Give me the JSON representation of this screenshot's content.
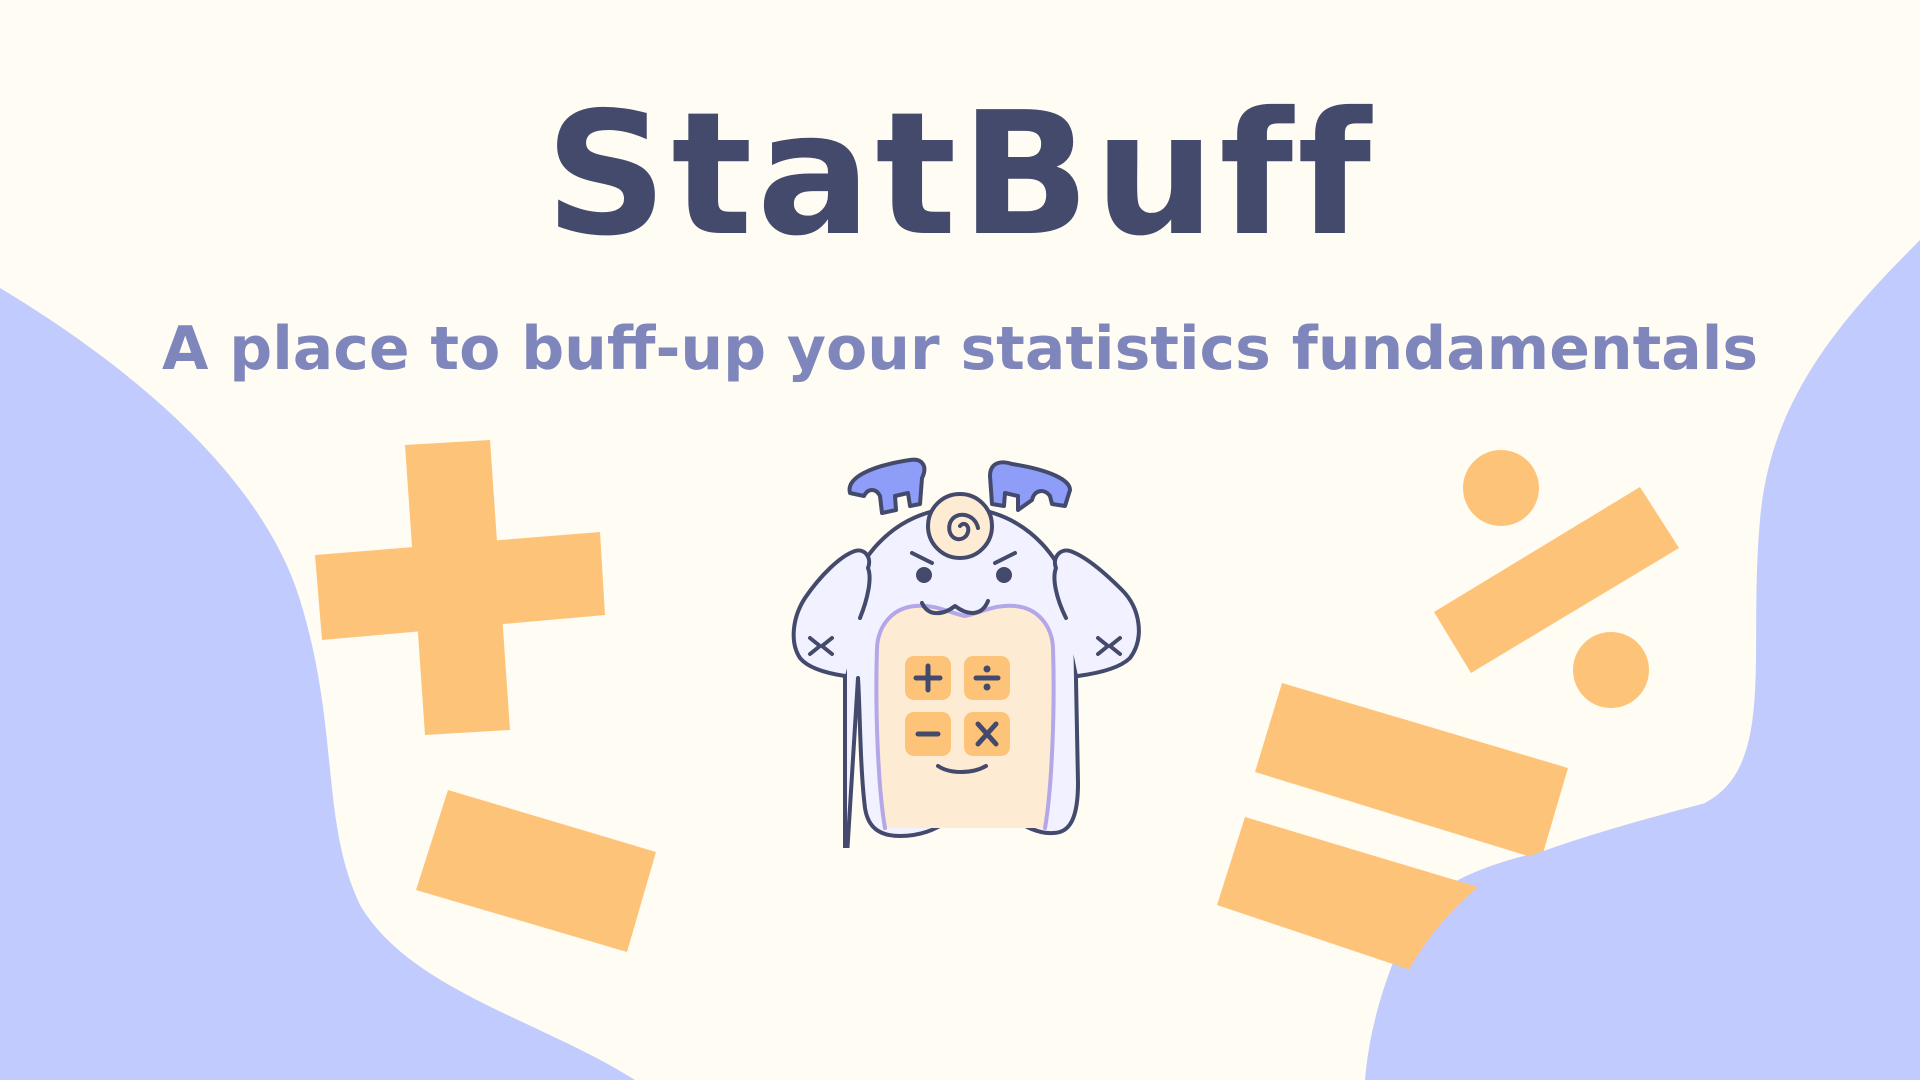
{
  "hero": {
    "title": "StatBuff",
    "subtitle": "A place to buff-up your statistics fundamentals"
  },
  "colors": {
    "background": "#FFFCF3",
    "title": "#434A6B",
    "subtitle": "#7F86BC",
    "blob": "#C1CBFD",
    "symbol": "#FDC479",
    "mascot_body": "#F1F1FF",
    "mascot_outline": "#434A6B",
    "mascot_horn": "#8E9DF8",
    "mascot_belly": "#FEEBD4",
    "calc_key": "#FDC479"
  },
  "decorations": {
    "symbols": [
      "plus-sign",
      "minus-sign",
      "percent-sign",
      "equals-sign"
    ]
  },
  "mascot": {
    "icon": "muscle-calculator-mascot",
    "calculator_keys": [
      "plus",
      "divide",
      "minus",
      "multiply"
    ]
  }
}
